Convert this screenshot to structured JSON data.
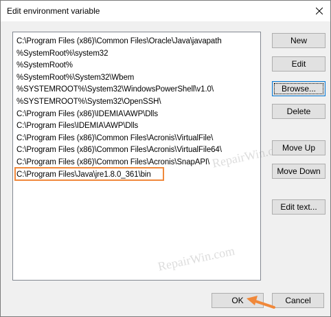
{
  "window": {
    "title": "Edit environment variable"
  },
  "list": {
    "items": [
      "C:\\Program Files (x86)\\Common Files\\Oracle\\Java\\javapath",
      "%SystemRoot%\\system32",
      "%SystemRoot%",
      "%SystemRoot%\\System32\\Wbem",
      "%SYSTEMROOT%\\System32\\WindowsPowerShell\\v1.0\\",
      "%SYSTEMROOT%\\System32\\OpenSSH\\",
      "C:\\Program Files (x86)\\IDEMIA\\AWP\\Dlls",
      "C:\\Program Files\\IDEMIA\\AWP\\Dlls",
      "C:\\Program Files (x86)\\Common Files\\Acronis\\VirtualFile\\",
      "C:\\Program Files (x86)\\Common Files\\Acronis\\VirtualFile64\\",
      "C:\\Program Files (x86)\\Common Files\\Acronis\\SnapAPI\\",
      "C:\\Program Files\\Java\\jre1.8.0_361\\bin"
    ],
    "highlighted_index": 11
  },
  "buttons": {
    "new": "New",
    "edit": "Edit",
    "browse": "Browse...",
    "delete": "Delete",
    "move_up": "Move Up",
    "move_down": "Move Down",
    "edit_text": "Edit text...",
    "ok": "OK",
    "cancel": "Cancel"
  },
  "watermark": "RepairWin.com",
  "colors": {
    "highlight": "#f0883a",
    "focus": "#0078d7"
  }
}
